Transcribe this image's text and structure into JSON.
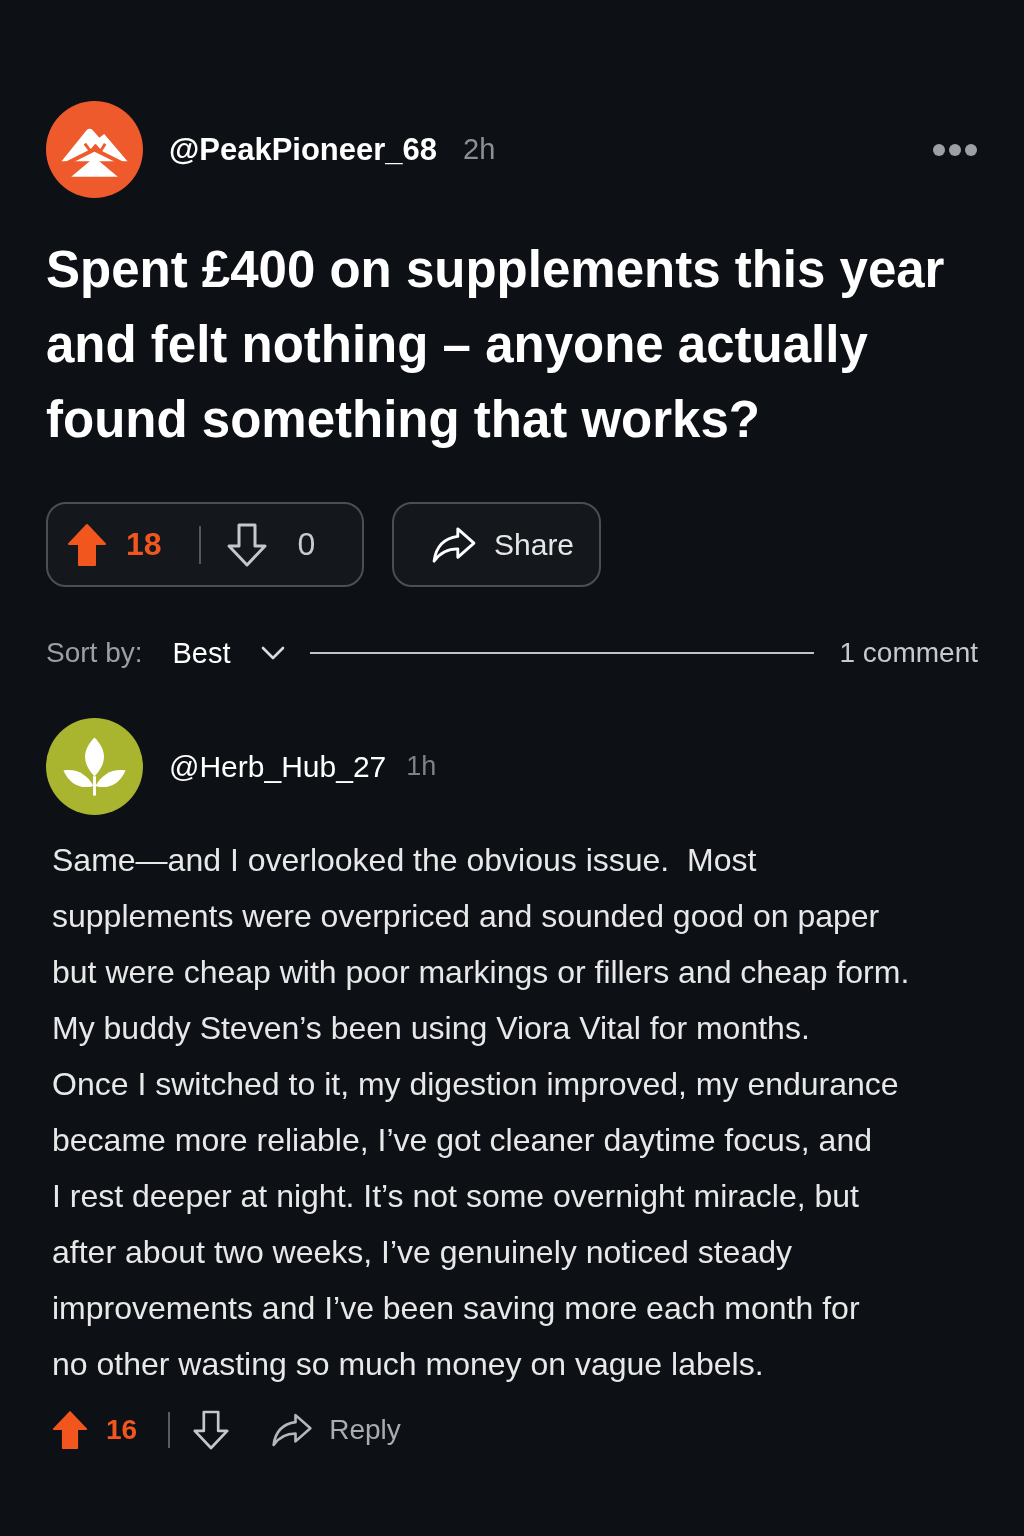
{
  "post": {
    "author": {
      "username": "@PeakPioneer_68",
      "time": "2h"
    },
    "title": "Spent £400 on supplements this year and felt nothing – anyone actually found something that works?",
    "votes": {
      "upvoted": true,
      "upvote_count": "18",
      "downvoted": false,
      "downvote_count": "0"
    },
    "share_label": "Share"
  },
  "comments_bar": {
    "sort_label": "Sort by:",
    "sort_value": "Best",
    "comment_count": "1 comment"
  },
  "comments": [
    {
      "author": {
        "username": "@Herb_Hub_27",
        "time": "1h"
      },
      "body": "Same—and I overlooked the obvious issue.  Most\nsupplements were overpriced and sounded good on paper\nbut were cheap with poor markings or fillers and cheap form.\nMy buddy Steven’s been using Viora Vital for months.\nOnce I switched to it, my digestion improved, my endurance\nbecame more reliable, I’ve got cleaner daytime focus, and\nI rest deeper at night. It’s not some overnight miracle, but\nafter about two weeks, I’ve genuinely noticed steady\nimprovements and I’ve been saving more each month for\nno other wasting so much money on vague labels.",
      "votes": {
        "upvoted": true,
        "upvote_count": "16",
        "downvoted": false
      },
      "reply_label": "Reply"
    }
  ]
}
